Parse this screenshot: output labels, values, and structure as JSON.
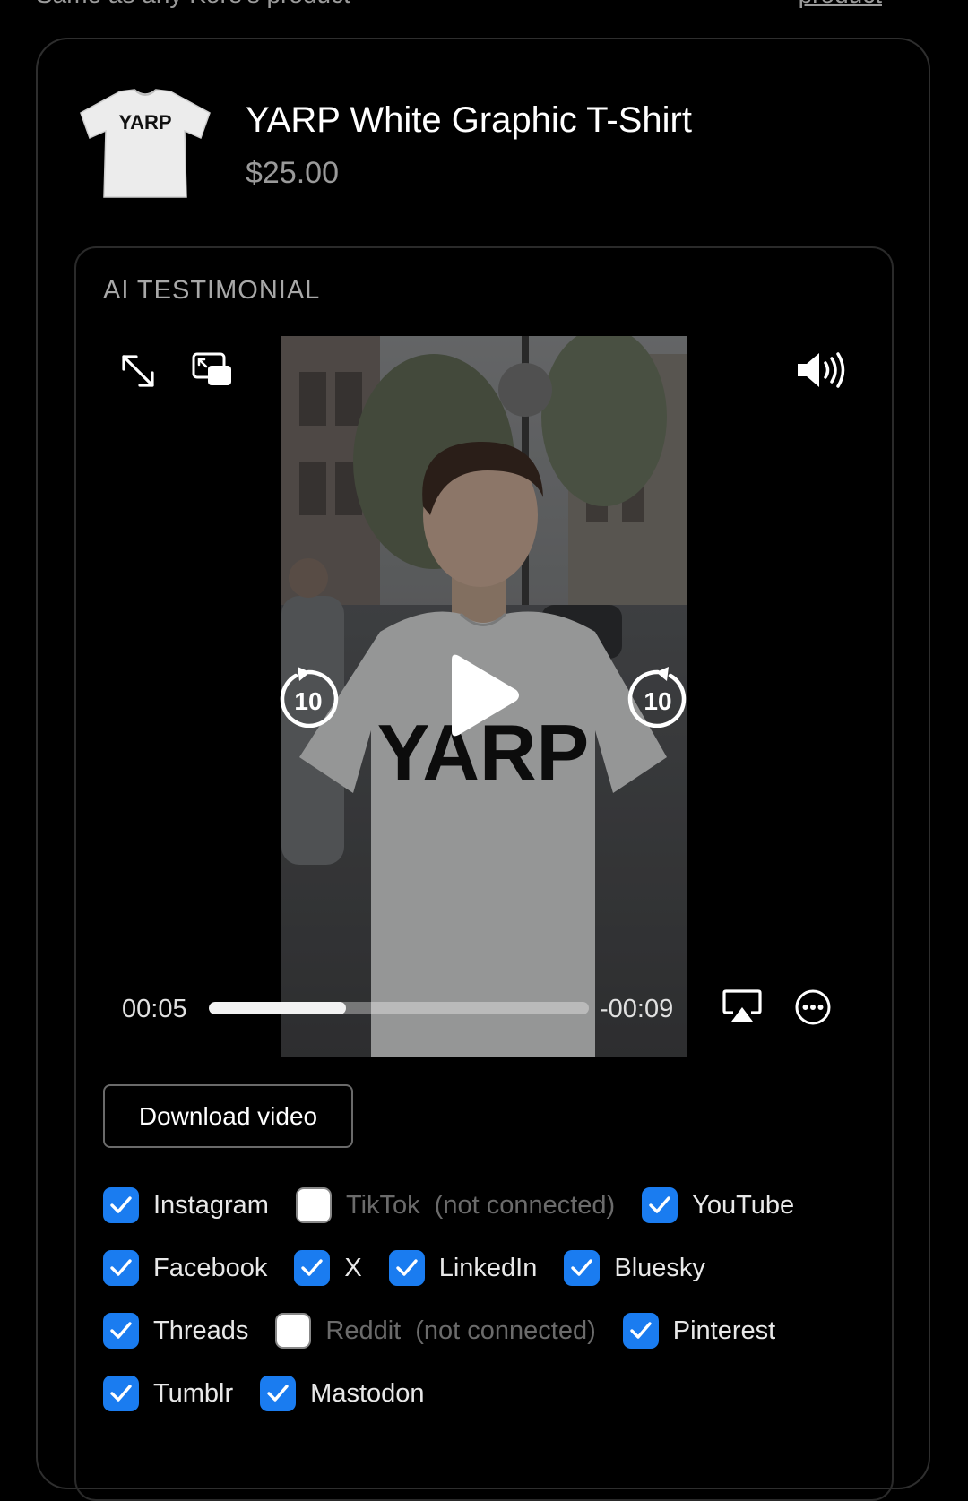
{
  "header_partial": {
    "text": "Same as any Kore's product",
    "link": "product"
  },
  "product": {
    "title": "YARP White Graphic T-Shirt",
    "price": "$25.00",
    "shirt_print": "YARP"
  },
  "testimonial": {
    "section_label": "AI TESTIMONIAL",
    "player": {
      "elapsed": "00:05",
      "remaining": "-00:09",
      "progress_fraction": 0.36,
      "skip_back_seconds": "10",
      "skip_forward_seconds": "10",
      "icons": [
        "fullscreen-icon",
        "picture-in-picture-icon",
        "volume-icon",
        "play-icon",
        "skip-back-10-icon",
        "skip-forward-10-icon",
        "airplay-icon",
        "more-options-icon"
      ]
    },
    "download_label": "Download video",
    "platforms": [
      [
        {
          "name": "Instagram",
          "checked": true
        },
        {
          "name": "TikTok",
          "checked": false,
          "status": "(not connected)"
        },
        {
          "name": "YouTube",
          "checked": true
        }
      ],
      [
        {
          "name": "Facebook",
          "checked": true
        },
        {
          "name": "X",
          "checked": true
        },
        {
          "name": "LinkedIn",
          "checked": true
        },
        {
          "name": "Bluesky",
          "checked": true
        }
      ],
      [
        {
          "name": "Threads",
          "checked": true
        },
        {
          "name": "Reddit",
          "checked": false,
          "status": "(not connected)"
        },
        {
          "name": "Pinterest",
          "checked": true
        }
      ],
      [
        {
          "name": "Tumblr",
          "checked": true
        },
        {
          "name": "Mastodon",
          "checked": true
        }
      ]
    ]
  },
  "colors": {
    "background": "#000000",
    "checkbox_accent": "#1a7cf0",
    "muted_text": "#9a9a9a",
    "disabled_text": "#6b6b6b"
  }
}
